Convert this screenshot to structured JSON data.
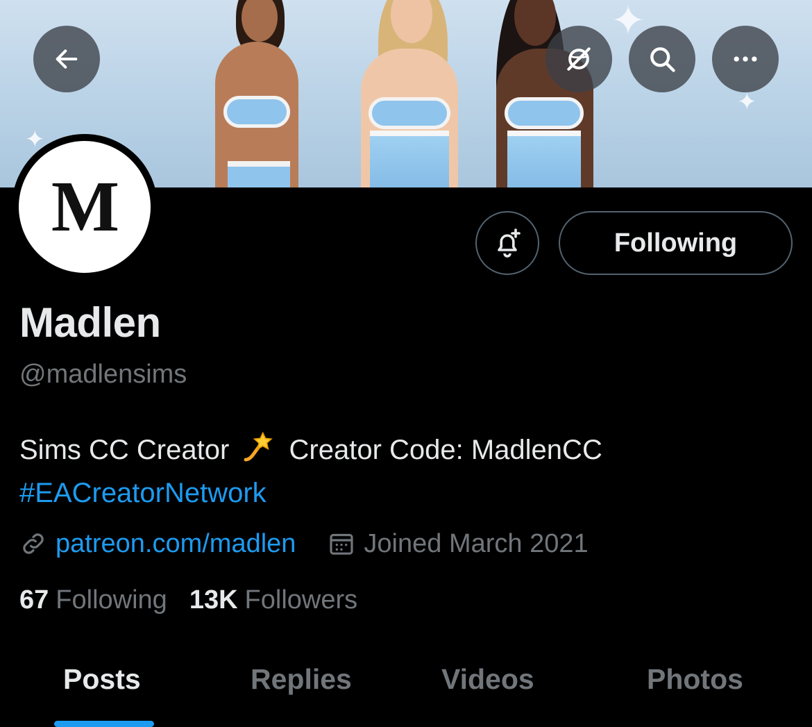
{
  "header": {
    "back_icon": "arrow-left-icon",
    "actions": [
      "translate-off-icon",
      "search-icon",
      "more-icon"
    ]
  },
  "profile": {
    "avatar_letter": "M",
    "display_name": "Madlen",
    "handle": "@madlensims",
    "bio_line1": "Sims CC Creator",
    "bio_emoji": "dizzy-star-emoji",
    "bio_line1_rest": "Creator Code: MadlenCC",
    "bio_hashtag": "#EACreatorNetwork",
    "website": "patreon.com/madlen",
    "joined": "Joined March 2021",
    "following_count": "67",
    "following_label": "Following",
    "followers_count": "13K",
    "followers_label": "Followers"
  },
  "actions": {
    "follow_button_label": "Following"
  },
  "tabs": [
    {
      "label": "Posts",
      "active": true
    },
    {
      "label": "Replies",
      "active": false
    },
    {
      "label": "Videos",
      "active": false
    },
    {
      "label": "Photos",
      "active": false
    }
  ],
  "colors": {
    "background": "#000000",
    "accent": "#1d9bf0",
    "secondary_text": "#71767b",
    "border": "#536471"
  }
}
